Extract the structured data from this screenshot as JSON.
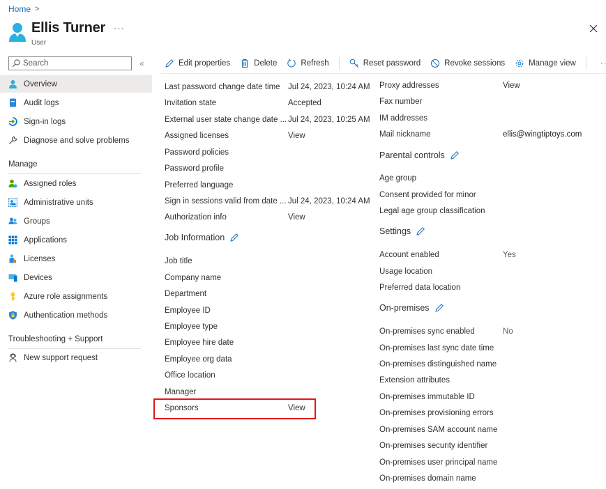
{
  "breadcrumb": {
    "home": "Home",
    "separator": ">"
  },
  "header": {
    "title": "Ellis Turner",
    "subtitle": "User",
    "more": "···"
  },
  "sidebar": {
    "search_placeholder": "Search",
    "collapse": "«",
    "items": [
      {
        "label": "Overview",
        "icon": "user-icon",
        "active": true
      },
      {
        "label": "Audit logs",
        "icon": "audit-log-icon"
      },
      {
        "label": "Sign-in logs",
        "icon": "sign-in-icon"
      },
      {
        "label": "Diagnose and solve problems",
        "icon": "wrench-icon"
      }
    ],
    "manage_heading": "Manage",
    "manage_items": [
      {
        "label": "Assigned roles",
        "icon": "assigned-roles-icon"
      },
      {
        "label": "Administrative units",
        "icon": "admin-units-icon"
      },
      {
        "label": "Groups",
        "icon": "groups-icon"
      },
      {
        "label": "Applications",
        "icon": "applications-grid-icon"
      },
      {
        "label": "Licenses",
        "icon": "licenses-icon"
      },
      {
        "label": "Devices",
        "icon": "devices-icon"
      },
      {
        "label": "Azure role assignments",
        "icon": "key-icon"
      },
      {
        "label": "Authentication methods",
        "icon": "shield-lock-icon"
      }
    ],
    "support_heading": "Troubleshooting + Support",
    "support_items": [
      {
        "label": "New support request",
        "icon": "support-person-icon"
      }
    ]
  },
  "toolbar": {
    "edit": "Edit properties",
    "delete": "Delete",
    "refresh": "Refresh",
    "reset_password": "Reset password",
    "revoke_sessions": "Revoke sessions",
    "manage_view": "Manage view",
    "more": "···"
  },
  "left_column": {
    "rows": [
      {
        "label": "Last password change date time",
        "value": "Jul 24, 2023, 10:24 AM"
      },
      {
        "label": "Invitation state",
        "value": "Accepted"
      },
      {
        "label": "External user state change date ...",
        "value": "Jul 24, 2023, 10:25 AM"
      },
      {
        "label": "Assigned licenses",
        "value": "View",
        "link": true
      },
      {
        "label": "Password policies",
        "value": ""
      },
      {
        "label": "Password profile",
        "value": ""
      },
      {
        "label": "Preferred language",
        "value": ""
      },
      {
        "label": "Sign in sessions valid from date ...",
        "value": "Jul 24, 2023, 10:24 AM"
      },
      {
        "label": "Authorization info",
        "value": "View",
        "link": true
      }
    ],
    "job_heading": "Job Information",
    "job_rows": [
      {
        "label": "Job title",
        "value": ""
      },
      {
        "label": "Company name",
        "value": ""
      },
      {
        "label": "Department",
        "value": ""
      },
      {
        "label": "Employee ID",
        "value": ""
      },
      {
        "label": "Employee type",
        "value": ""
      },
      {
        "label": "Employee hire date",
        "value": ""
      },
      {
        "label": "Employee org data",
        "value": ""
      },
      {
        "label": "Office location",
        "value": ""
      },
      {
        "label": "Manager",
        "value": ""
      },
      {
        "label": "Sponsors",
        "value": "View",
        "link": true
      }
    ]
  },
  "right_column": {
    "contact_rows": [
      {
        "label": "Proxy addresses",
        "value": "View",
        "link": true
      },
      {
        "label": "Fax number",
        "value": ""
      },
      {
        "label": "IM addresses",
        "value": ""
      },
      {
        "label": "Mail nickname",
        "value": "ellis@wingtiptoys.com"
      }
    ],
    "parental_heading": "Parental controls",
    "parental_rows": [
      {
        "label": "Age group",
        "value": ""
      },
      {
        "label": "Consent provided for minor",
        "value": ""
      },
      {
        "label": "Legal age group classification",
        "value": ""
      }
    ],
    "settings_heading": "Settings",
    "settings_rows": [
      {
        "label": "Account enabled",
        "value": "Yes"
      },
      {
        "label": "Usage location",
        "value": ""
      },
      {
        "label": "Preferred data location",
        "value": ""
      }
    ],
    "onprem_heading": "On-premises",
    "onprem_rows": [
      {
        "label": "On-premises sync enabled",
        "value": "No"
      },
      {
        "label": "On-premises last sync date time",
        "value": ""
      },
      {
        "label": "On-premises distinguished name",
        "value": ""
      },
      {
        "label": "Extension attributes",
        "value": ""
      },
      {
        "label": "On-premises immutable ID",
        "value": ""
      },
      {
        "label": "On-premises provisioning errors",
        "value": ""
      },
      {
        "label": "On-premises SAM account name",
        "value": ""
      },
      {
        "label": "On-premises security identifier",
        "value": ""
      },
      {
        "label": "On-premises user principal name",
        "value": ""
      },
      {
        "label": "On-premises domain name",
        "value": ""
      }
    ]
  },
  "colors": {
    "accent": "#0f6cbd",
    "highlight_border": "#e3151a",
    "active_nav": "#edebe9",
    "user_icon": "#2bb0e0"
  }
}
